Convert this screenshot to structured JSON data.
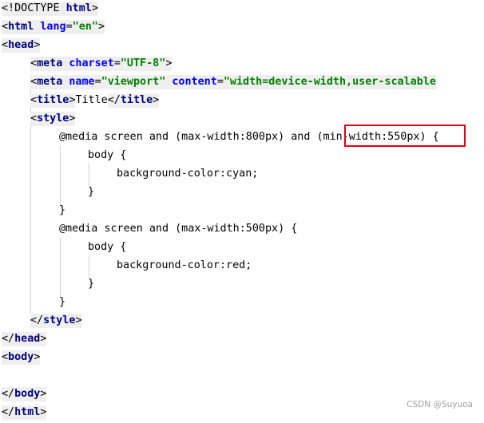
{
  "editor": {
    "lines": [
      {
        "segments": [
          {
            "text": "<!DOCTYPE ",
            "cls": "plain hl"
          },
          {
            "text": "html",
            "cls": "tag hl"
          },
          {
            "text": ">",
            "cls": "plain hl"
          }
        ]
      },
      {
        "segments": [
          {
            "text": "<",
            "cls": "plain hl"
          },
          {
            "text": "html",
            "cls": "tag hl"
          },
          {
            "text": " ",
            "cls": "plain hl"
          },
          {
            "text": "lang",
            "cls": "attr hl"
          },
          {
            "text": "=",
            "cls": "plain hl"
          },
          {
            "text": "\"en\"",
            "cls": "str hl"
          },
          {
            "text": ">",
            "cls": "plain hl"
          }
        ]
      },
      {
        "segments": [
          {
            "text": "<",
            "cls": "plain hl"
          },
          {
            "text": "head",
            "cls": "tag hl"
          },
          {
            "text": ">",
            "cls": "plain hl"
          }
        ]
      },
      {
        "segments": [
          {
            "text": "<",
            "cls": "plain hl"
          },
          {
            "text": "meta",
            "cls": "tag hl"
          },
          {
            "text": " ",
            "cls": "plain hl"
          },
          {
            "text": "charset",
            "cls": "attr hl"
          },
          {
            "text": "=",
            "cls": "plain hl"
          },
          {
            "text": "\"UTF-8\"",
            "cls": "str hl"
          },
          {
            "text": ">",
            "cls": "plain hl"
          }
        ]
      },
      {
        "segments": [
          {
            "text": "<",
            "cls": "plain hl"
          },
          {
            "text": "meta",
            "cls": "tag hl"
          },
          {
            "text": " ",
            "cls": "plain hl"
          },
          {
            "text": "name",
            "cls": "attr hl"
          },
          {
            "text": "=",
            "cls": "plain hl"
          },
          {
            "text": "\"viewport\"",
            "cls": "str hl"
          },
          {
            "text": " ",
            "cls": "plain hl"
          },
          {
            "text": "content",
            "cls": "attr hl"
          },
          {
            "text": "=",
            "cls": "plain hl"
          },
          {
            "text": "\"width=device-width,user-scalable",
            "cls": "str hl"
          }
        ]
      },
      {
        "segments": [
          {
            "text": "<",
            "cls": "plain hl"
          },
          {
            "text": "title",
            "cls": "tag hl"
          },
          {
            "text": ">",
            "cls": "plain hl"
          },
          {
            "text": "Title",
            "cls": "plain"
          },
          {
            "text": "</",
            "cls": "plain hl"
          },
          {
            "text": "title",
            "cls": "tag hl"
          },
          {
            "text": ">",
            "cls": "plain hl"
          }
        ]
      },
      {
        "segments": [
          {
            "text": "<",
            "cls": "plain hl"
          },
          {
            "text": "style",
            "cls": "tag hl"
          },
          {
            "text": ">",
            "cls": "plain hl"
          }
        ]
      },
      {
        "segments": [
          {
            "text": "@media screen and (max-width:800px) and (min-width:550px) {",
            "cls": "plain"
          }
        ]
      },
      {
        "segments": [
          {
            "text": "body {",
            "cls": "plain"
          }
        ]
      },
      {
        "segments": [
          {
            "text": "background-color:cyan;",
            "cls": "plain"
          }
        ]
      },
      {
        "segments": [
          {
            "text": "}",
            "cls": "plain"
          }
        ]
      },
      {
        "segments": [
          {
            "text": "}",
            "cls": "plain"
          }
        ]
      },
      {
        "segments": [
          {
            "text": "@media screen and (max-width:500px) {",
            "cls": "plain"
          }
        ]
      },
      {
        "segments": [
          {
            "text": "body {",
            "cls": "plain"
          }
        ]
      },
      {
        "segments": [
          {
            "text": "background-color:red;",
            "cls": "plain"
          }
        ]
      },
      {
        "segments": [
          {
            "text": "}",
            "cls": "plain"
          }
        ]
      },
      {
        "segments": [
          {
            "text": "}",
            "cls": "plain"
          }
        ]
      },
      {
        "segments": [
          {
            "text": "</",
            "cls": "plain hl"
          },
          {
            "text": "style",
            "cls": "tag hl"
          },
          {
            "text": ">",
            "cls": "plain hl"
          }
        ]
      },
      {
        "segments": [
          {
            "text": "</",
            "cls": "plain hl"
          },
          {
            "text": "head",
            "cls": "tag hl"
          },
          {
            "text": ">",
            "cls": "plain hl"
          }
        ]
      },
      {
        "segments": [
          {
            "text": "<",
            "cls": "plain hl"
          },
          {
            "text": "body",
            "cls": "tag hl"
          },
          {
            "text": ">",
            "cls": "plain hl"
          }
        ]
      },
      {
        "segments": []
      },
      {
        "segments": [
          {
            "text": "</",
            "cls": "plain hl"
          },
          {
            "text": "body",
            "cls": "tag hl"
          },
          {
            "text": ">",
            "cls": "plain hl"
          }
        ]
      },
      {
        "segments": [
          {
            "text": "</",
            "cls": "plain hl"
          },
          {
            "text": "html",
            "cls": "tag hl"
          },
          {
            "text": ">",
            "cls": "plain hl"
          }
        ]
      }
    ]
  },
  "watermark": "CSDN @Suyuoa",
  "colors": {
    "tag": "#000080",
    "attribute": "#0000ff",
    "string": "#008000",
    "highlight_box": "#e60012",
    "tag_background": "#efefef"
  }
}
